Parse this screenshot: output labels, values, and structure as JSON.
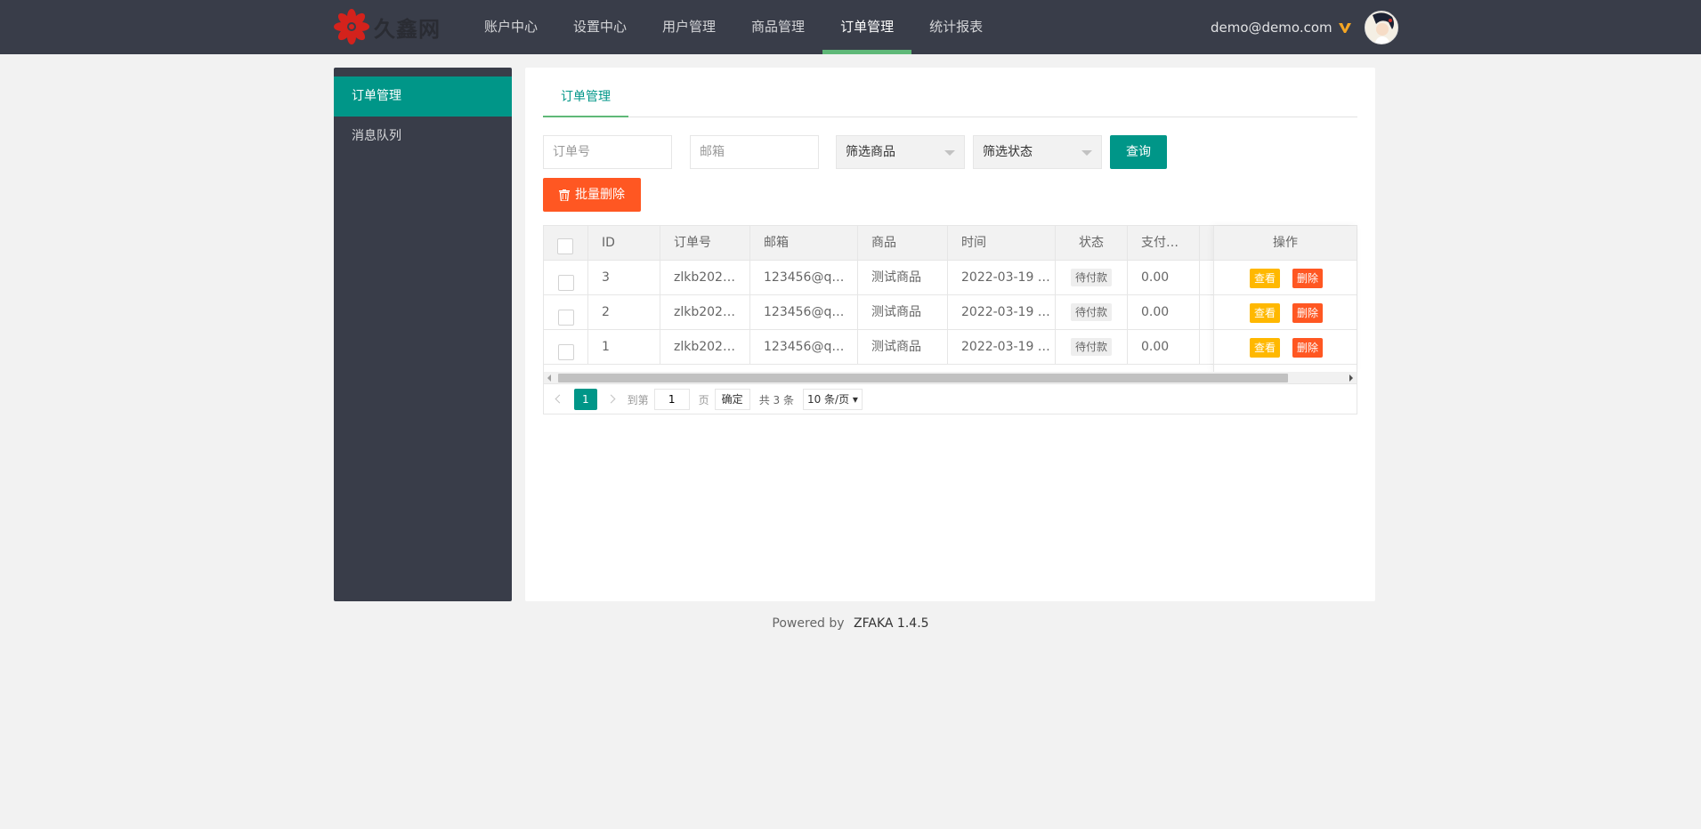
{
  "header": {
    "brand": "久鑫网",
    "nav": [
      {
        "label": "账户中心",
        "active": false
      },
      {
        "label": "设置中心",
        "active": false
      },
      {
        "label": "用户管理",
        "active": false
      },
      {
        "label": "商品管理",
        "active": false
      },
      {
        "label": "订单管理",
        "active": true
      },
      {
        "label": "统计报表",
        "active": false
      }
    ],
    "user_email": "demo@demo.com",
    "vip_icon": "vip-v-icon",
    "avatar_icon": "user-avatar"
  },
  "sidebar": {
    "items": [
      {
        "label": "订单管理",
        "active": true
      },
      {
        "label": "消息队列",
        "active": false
      }
    ]
  },
  "main": {
    "tab": "订单管理",
    "filters": {
      "order_no_placeholder": "订单号",
      "email_placeholder": "邮箱",
      "product_select": "筛选商品",
      "status_select": "筛选状态",
      "query_button": "查询"
    },
    "batch_delete_button": "批量删除",
    "table": {
      "columns": [
        "ID",
        "订单号",
        "邮箱",
        "商品",
        "时间",
        "状态",
        "支付…",
        "操作"
      ],
      "rows": [
        {
          "id": "3",
          "order_no": "zlkb202…",
          "email": "123456@q…",
          "product": "测试商品",
          "time": "2022-03-19 …",
          "status": "待付款",
          "paid": "0.00"
        },
        {
          "id": "2",
          "order_no": "zlkb202…",
          "email": "123456@q…",
          "product": "测试商品",
          "time": "2022-03-19 …",
          "status": "待付款",
          "paid": "0.00"
        },
        {
          "id": "1",
          "order_no": "zlkb202…",
          "email": "123456@q…",
          "product": "测试商品",
          "time": "2022-03-19 …",
          "status": "待付款",
          "paid": "0.00"
        }
      ],
      "view_label": "查看",
      "delete_label": "删除"
    },
    "pager": {
      "current_page": "1",
      "goto_label": "到第",
      "goto_value": "1",
      "page_unit": "页",
      "confirm_label": "确定",
      "total_label": "共 3 条",
      "page_size": "10 条/页"
    }
  },
  "footer": {
    "powered_by": "Powered by",
    "product": "ZFAKA 1.4.5"
  },
  "colors": {
    "header_bg": "#393d49",
    "accent": "#009688",
    "nav_active_bar": "#5fb878",
    "danger": "#ff5722",
    "warn": "#ffb800"
  }
}
